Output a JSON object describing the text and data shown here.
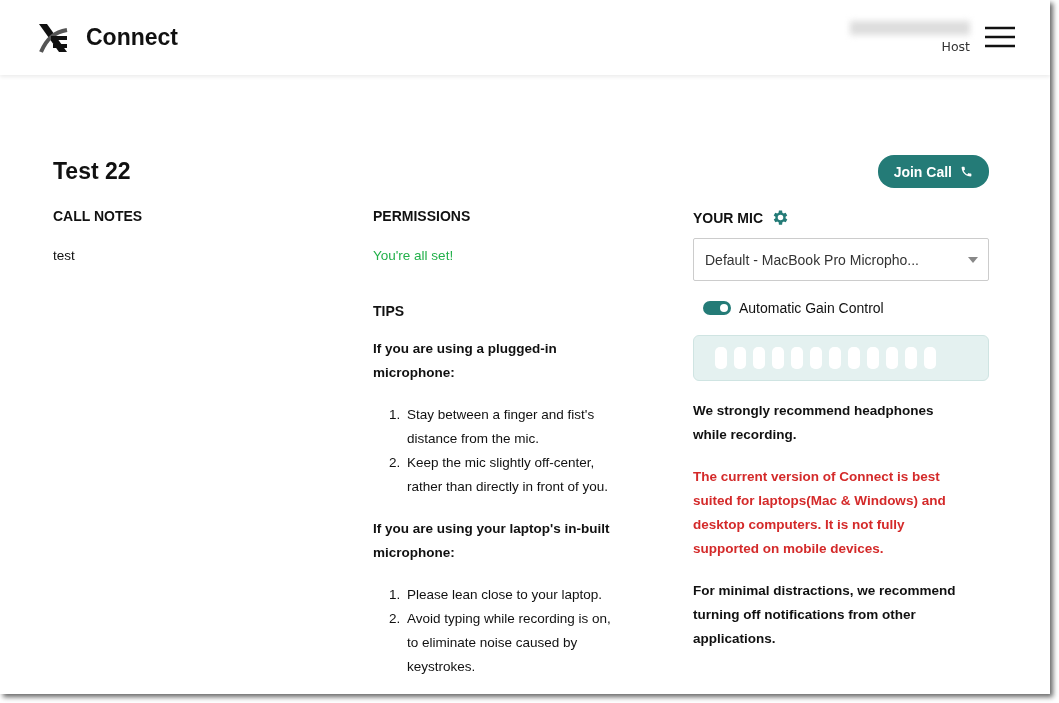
{
  "header": {
    "app_name": "Connect",
    "role": "Host"
  },
  "page": {
    "title": "Test 22",
    "join_button": "Join Call"
  },
  "call_notes": {
    "heading": "CALL NOTES",
    "text": "test"
  },
  "permissions": {
    "heading": "PERMISSIONS",
    "status": "You're all set!"
  },
  "tips": {
    "heading": "TIPS",
    "groups": [
      {
        "title": "If you are using a plugged-in microphone:",
        "items": [
          {
            "number": "1.",
            "text": "Stay between a finger and fist's distance from the mic."
          },
          {
            "number": "2.",
            "text": "Keep the mic slightly off-center, rather than directly in front of you."
          }
        ]
      },
      {
        "title": "If you are using your laptop's in-built microphone:",
        "items": [
          {
            "number": "1.",
            "text": "Please lean close to your laptop."
          },
          {
            "number": "2.",
            "text": "Avoid typing while recording is on, to eliminate noise caused by keystrokes."
          }
        ]
      }
    ]
  },
  "mic": {
    "heading": "YOUR MIC",
    "device": "Default - MacBook Pro Micropho...",
    "agc": {
      "label": "Automatic Gain Control",
      "on": true
    },
    "notes": [
      {
        "kind": "normal",
        "text": "We strongly recommend headphones while recording."
      },
      {
        "kind": "warning",
        "text": "The current version of Connect is best suited for laptops(Mac & Windows) and desktop computers. It is not fully supported on mobile devices."
      },
      {
        "kind": "normal",
        "text": "For minimal distractions, we recommend turning off notifications from other applications."
      }
    ]
  }
}
